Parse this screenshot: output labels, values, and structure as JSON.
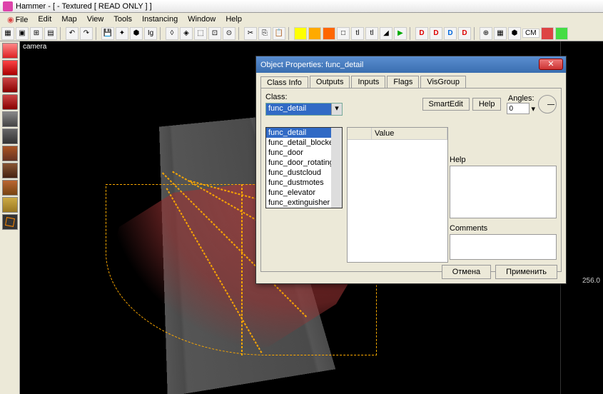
{
  "title": "Hammer - [ - Textured [ READ ONLY ] ]",
  "menu": [
    "File",
    "Edit",
    "Map",
    "View",
    "Tools",
    "Instancing",
    "Window",
    "Help"
  ],
  "toolbar_labels": {
    "cm": "CM"
  },
  "viewport_label": "camera",
  "ruler_tick": "256.0",
  "dialog": {
    "title": "Object Properties: func_detail",
    "tabs": [
      "Class Info",
      "Outputs",
      "Inputs",
      "Flags",
      "VisGroup"
    ],
    "class_label": "Class:",
    "class_value": "func_detail",
    "dropdown": [
      "func_detail",
      "func_detail_blocker",
      "func_door",
      "func_door_rotating",
      "func_dustcloud",
      "func_dustmotes",
      "func_elevator",
      "func_extinguisher"
    ],
    "kv_header": {
      "key": "",
      "value": "Value"
    },
    "smartedit": "SmartEdit",
    "help_btn": "Help",
    "angles_label": "Angles:",
    "angles_value": "0",
    "help_label": "Help",
    "comments_label": "Comments",
    "cancel": "Отмена",
    "apply": "Применить"
  }
}
